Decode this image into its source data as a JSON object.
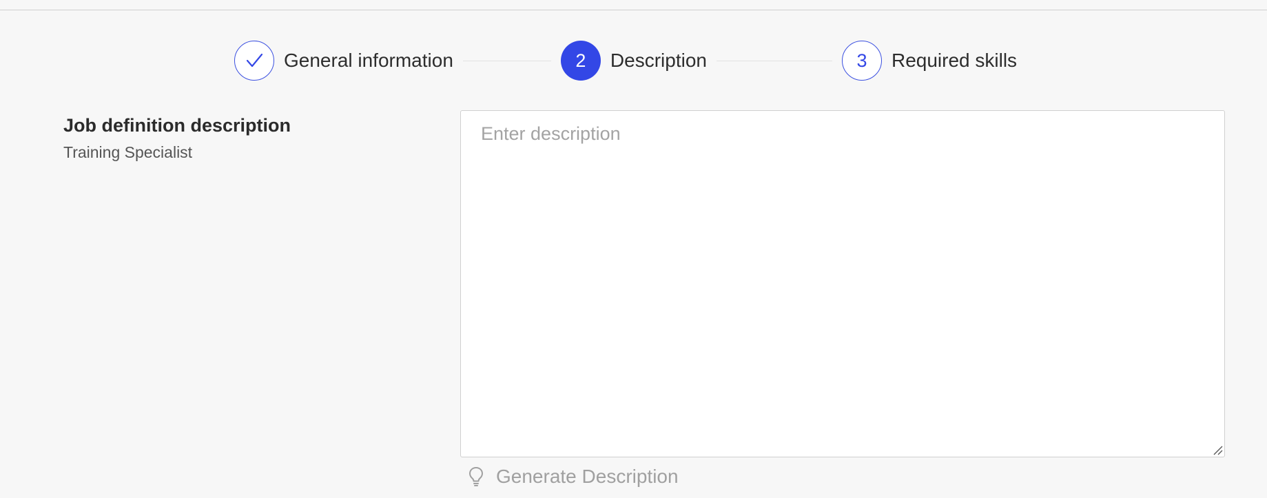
{
  "stepper": {
    "steps": [
      {
        "number": "",
        "label": "General information",
        "status": "completed",
        "icon": "check-icon"
      },
      {
        "number": "2",
        "label": "Description",
        "status": "active"
      },
      {
        "number": "3",
        "label": "Required skills",
        "status": "pending"
      }
    ]
  },
  "section": {
    "title": "Job definition description",
    "subtitle": "Training Specialist"
  },
  "description": {
    "value": "",
    "placeholder": "Enter description"
  },
  "generate": {
    "label": "Generate Description",
    "icon": "lightbulb-icon"
  },
  "colors": {
    "accent": "#3347e6",
    "background": "#f7f7f7",
    "muted_text": "#a0a0a0"
  }
}
